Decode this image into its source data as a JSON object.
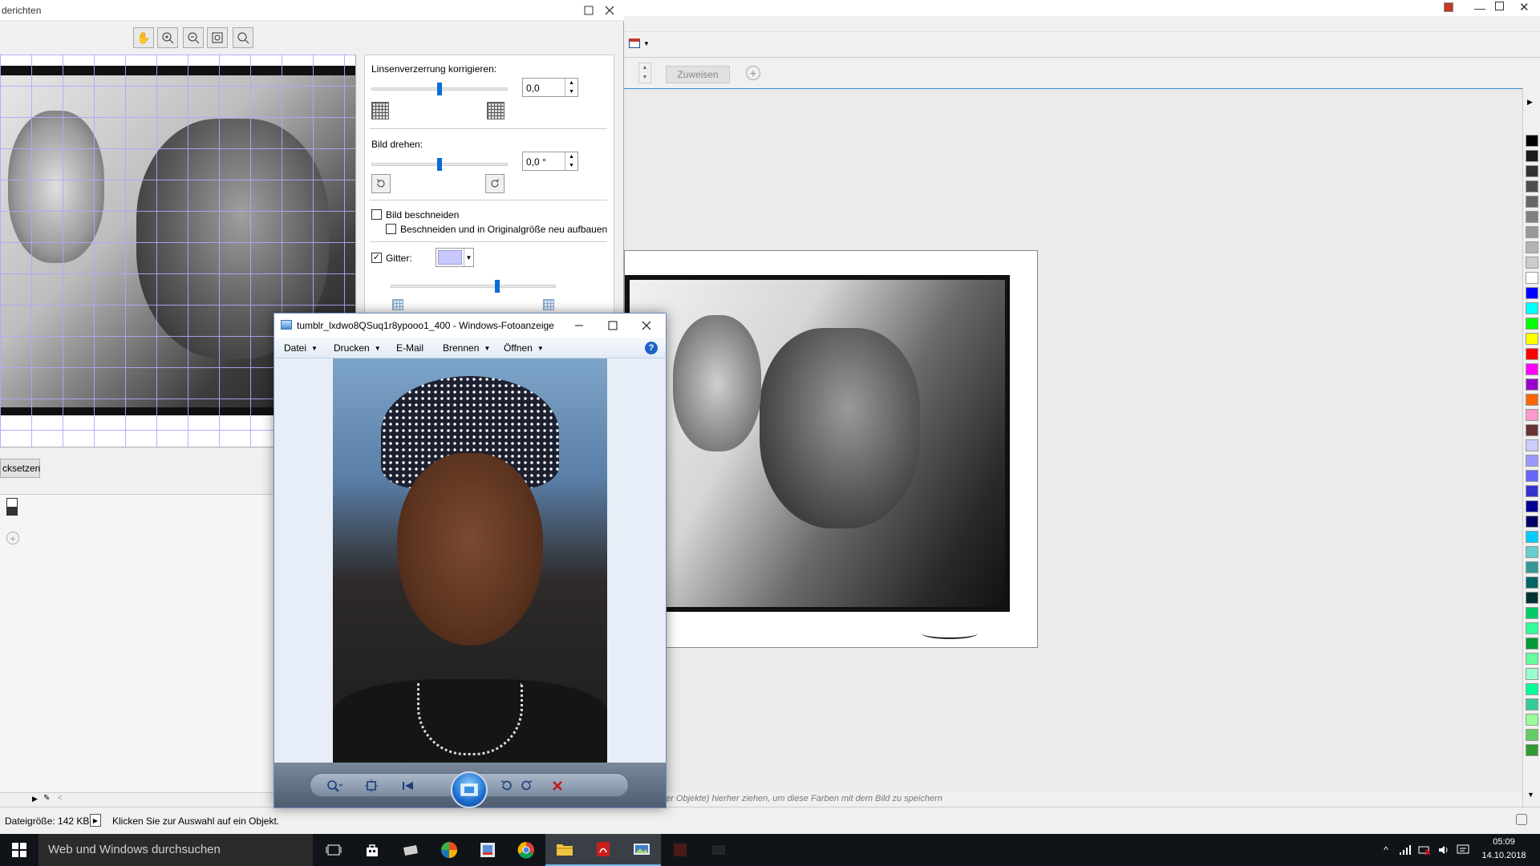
{
  "adjust_dialog": {
    "title": "derichten",
    "reset_label": "cksetzen",
    "lens": {
      "label": "Linsenverzerrung korrigieren:",
      "value": "0,0"
    },
    "rotate": {
      "label": "Bild drehen:",
      "value": "0,0 °"
    },
    "crop": {
      "label": "Bild beschneiden",
      "checked": false
    },
    "crop_rebuild": {
      "label": "Beschneiden und in Originalgröße neu aufbauen",
      "checked": false
    },
    "grid": {
      "label": "Gitter:",
      "checked": true,
      "color": "#c8c8ff"
    }
  },
  "background_app": {
    "assign_label": "Zuweisen",
    "palette_hint": "er Objekte) hierher ziehen, um diese Farben mit dem Bild zu speichern",
    "palette_colors": [
      "#000000",
      "#1a1a1a",
      "#333333",
      "#4d4d4d",
      "#666666",
      "#808080",
      "#999999",
      "#b3b3b3",
      "#cccccc",
      "#ffffff",
      "#0000ff",
      "#00ffff",
      "#00ff00",
      "#ffff00",
      "#ff0000",
      "#ff00ff",
      "#9900cc",
      "#ff6600",
      "#ff99cc",
      "#663333",
      "#ccccff",
      "#9999ff",
      "#6666ff",
      "#3333cc",
      "#000099",
      "#000066",
      "#00ccff",
      "#66cccc",
      "#339999",
      "#006666",
      "#003333",
      "#00cc66",
      "#33ff99",
      "#009933",
      "#66ff99",
      "#99ffcc",
      "#00ff99",
      "#33cc99",
      "#99ff99",
      "#66cc66",
      "#339933"
    ]
  },
  "status_bar": {
    "file_size": "Dateigröße: 142 KB",
    "hint": "Klicken Sie zur Auswahl auf ein Objekt."
  },
  "photo_viewer": {
    "title": "tumblr_lxdwo8QSuq1r8ypooo1_400 - Windows-Fotoanzeige",
    "menu": [
      "Datei",
      "Drucken",
      "E-Mail",
      "Brennen",
      "Öffnen"
    ],
    "help": "?"
  },
  "taskbar": {
    "search_placeholder": "Web und Windows durchsuchen",
    "time": "05:09",
    "date": "14.10.2018"
  }
}
